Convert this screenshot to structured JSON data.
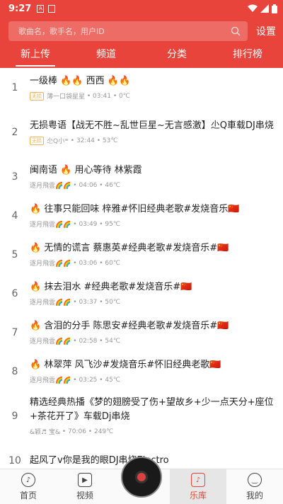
{
  "status": {
    "time": "9:27"
  },
  "search": {
    "placeholder": "歌曲名，歌手名，用户ID",
    "settings_label": "设置"
  },
  "tabs": [
    {
      "label": "新上传"
    },
    {
      "label": "频道"
    },
    {
      "label": "分类"
    },
    {
      "label": "排行榜"
    }
  ],
  "songs": [
    {
      "index": "1",
      "title": "一级棒 🔥🔥 西西 🔥🔥",
      "lossless": "无损",
      "uploader": "薄一口袋星星",
      "duration": "03:41",
      "temp": "0℃"
    },
    {
      "index": "2",
      "title": "无损粤语【战无不胜~乱世巨星~无言感激】尐Q車载DJ串烧",
      "lossless": "无损",
      "uploader": "尐Q小ᵆ",
      "duration": "32:44",
      "temp": "53℃"
    },
    {
      "index": "3",
      "title": "闽南语 🔥 用心等待 林紫霞",
      "lossless": "",
      "uploader": "逐月飛雲🌈🌈",
      "duration": "04:06",
      "temp": "46℃"
    },
    {
      "index": "4",
      "title": "🔥 往事只能回味 梓雅#怀旧经典老歌#发烧音乐🇨🇳",
      "lossless": "",
      "uploader": "逐月飛雲🌈🌈",
      "duration": "03:49",
      "temp": "95℃"
    },
    {
      "index": "5",
      "title": "🔥 无情的谎言 蔡惠英#经典老歌#发烧音乐#🇨🇳",
      "lossless": "",
      "uploader": "逐月飛雲🌈🌈",
      "duration": "03:06",
      "temp": "60℃"
    },
    {
      "index": "6",
      "title": "🔥 抹去泪水 #经典老歌#发烧音乐#🇨🇳",
      "lossless": "",
      "uploader": "逐月飛雲🌈🌈",
      "duration": "03:37",
      "temp": "50℃"
    },
    {
      "index": "7",
      "title": "🔥 含泪的分手 陈思安#经典老歌#发烧音乐#🇨🇳",
      "lossless": "",
      "uploader": "逐月飛雲🌈🌈",
      "duration": "02:58",
      "temp": "54℃"
    },
    {
      "index": "8",
      "title": "🔥 林翠萍 风飞沙#发烧音乐#怀旧经典老歌🇨🇳",
      "lossless": "",
      "uploader": "逐月飛雲🌈🌈",
      "duration": "03:25",
      "temp": "45℃"
    },
    {
      "index": "9",
      "title": "精选经典热播《梦的翅膀受了伤+望故乡+少一点天分+座位+茶花开了》车载Dj串烧",
      "lossless": "",
      "uploader": "&颖♬ 宝&",
      "duration": "70:06",
      "temp": "249℃"
    },
    {
      "index": "10",
      "title": "起风了v你是我的眼DJ串烧Electro",
      "lossless": "",
      "uploader": "",
      "duration": "",
      "temp": ""
    }
  ],
  "nav": [
    {
      "label": "首页",
      "icon": "music-note-icon"
    },
    {
      "label": "视频",
      "icon": "play-icon"
    },
    {
      "label": "",
      "icon": "record-icon"
    },
    {
      "label": "乐库",
      "icon": "library-icon"
    },
    {
      "label": "我的",
      "icon": "smile-icon"
    }
  ],
  "colors": {
    "accent": "#e8443c",
    "lossless_badge": "#f0b458"
  }
}
